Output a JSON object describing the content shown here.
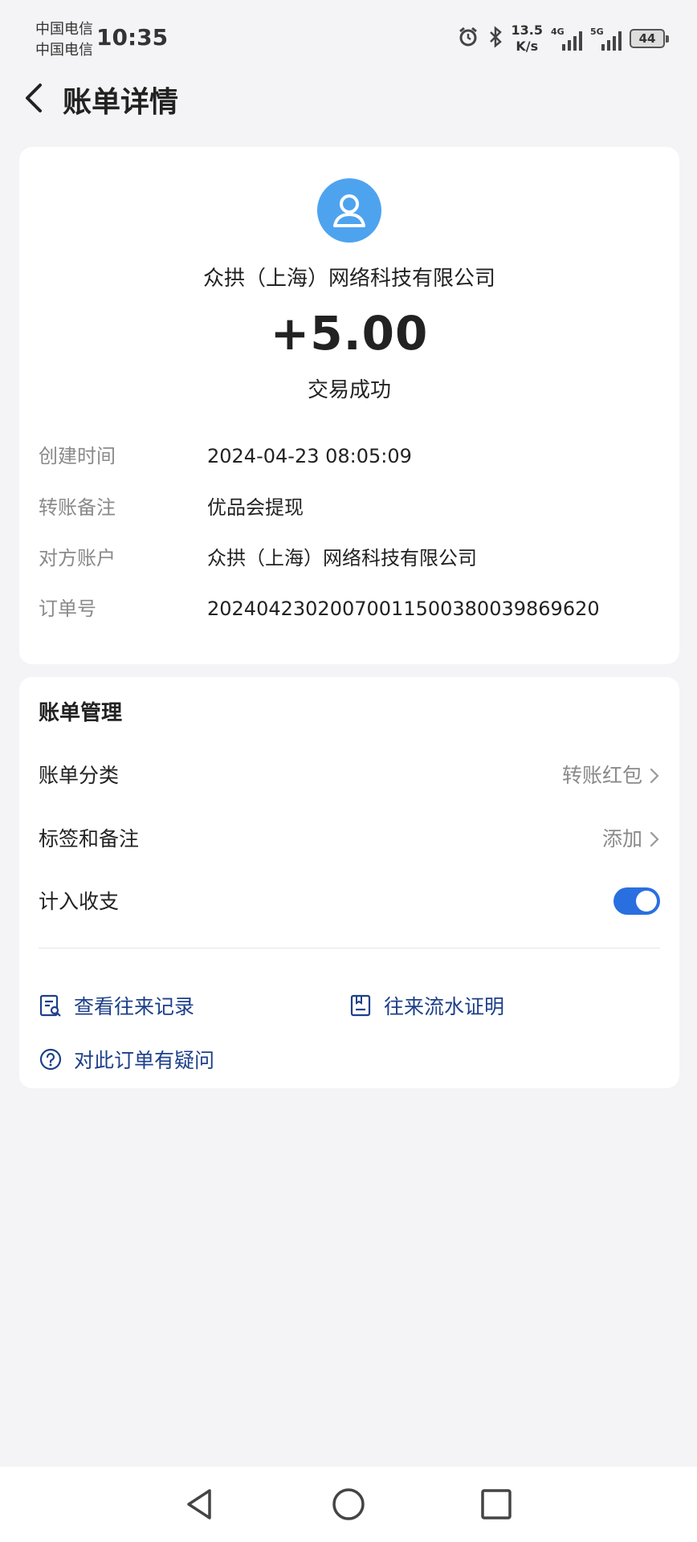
{
  "status_bar": {
    "carrier_1": "中国电信",
    "carrier_2": "中国电信",
    "time": "10:35",
    "net_speed_value": "13.5",
    "net_speed_unit": "K/s",
    "signal_1_tag": "4G",
    "signal_2_tag": "5G",
    "battery": "44"
  },
  "header": {
    "title": "账单详情"
  },
  "summary": {
    "payee": "众拱（上海）网络科技有限公司",
    "amount": "+5.00",
    "status": "交易成功"
  },
  "details": [
    {
      "label": "创建时间",
      "value": "2024-04-23 08:05:09"
    },
    {
      "label": "转账备注",
      "value": "优品会提现"
    },
    {
      "label": "对方账户",
      "value": "众拱（上海）网络科技有限公司"
    },
    {
      "label": "订单号",
      "value": "20240423020070011500380039869620"
    }
  ],
  "management": {
    "title": "账单管理",
    "category_label": "账单分类",
    "category_value": "转账红包",
    "tags_label": "标签和备注",
    "tags_value": "添加",
    "count_label": "计入收支",
    "count_enabled": true,
    "view_records": "查看往来记录",
    "flow_proof": "往来流水证明",
    "question": "对此订单有疑问"
  },
  "colors": {
    "accent": "#2a6fe0",
    "link": "#1d3f8a",
    "avatar": "#4ea3ef"
  }
}
